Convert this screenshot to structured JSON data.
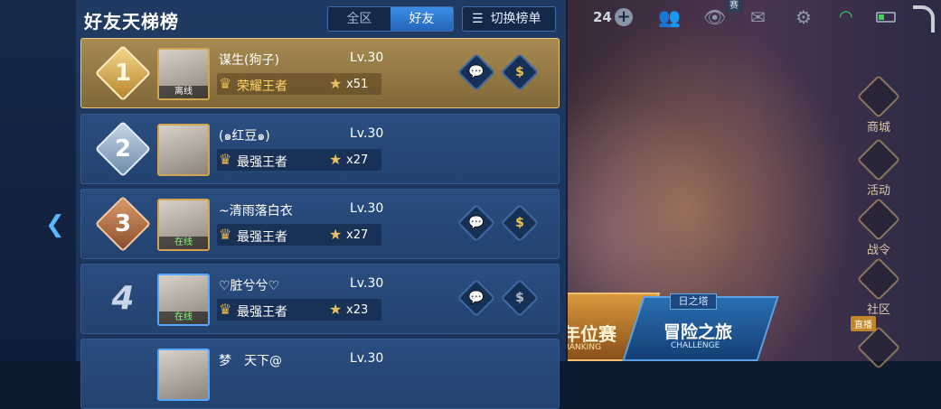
{
  "panel": {
    "title": "好友天梯榜",
    "tabs": [
      {
        "label": "全区",
        "active": false
      },
      {
        "label": "好友",
        "active": true
      }
    ],
    "switch_label": "切换榜单"
  },
  "rows": [
    {
      "rank": "1",
      "name": "谋生(狗子)",
      "level": "Lv.30",
      "tier": "荣耀王者",
      "stars": "x51",
      "status": "离线"
    },
    {
      "rank": "2",
      "name": "(๑红豆๑)",
      "level": "Lv.30",
      "tier": "最强王者",
      "stars": "x27",
      "status": ""
    },
    {
      "rank": "3",
      "name": "~清雨落白衣",
      "level": "Lv.30",
      "tier": "最强王者",
      "stars": "x27",
      "status": "在线"
    },
    {
      "rank": "4",
      "name": "♡脏兮兮♡",
      "level": "Lv.30",
      "tier": "最强王者",
      "stars": "x23",
      "status": "在线"
    },
    {
      "rank": "",
      "name": "梦　天下@",
      "level": "Lv.30",
      "tier": "",
      "stars": "",
      "status": ""
    }
  ],
  "topbar": {
    "count": "24",
    "sai": "赛"
  },
  "right_menu": [
    {
      "label": "商城",
      "icon": "shop-icon"
    },
    {
      "label": "活动",
      "icon": "gift-icon"
    },
    {
      "label": "战令",
      "icon": "flag-icon"
    },
    {
      "label": "社区",
      "icon": "community-icon"
    },
    {
      "label": "",
      "icon": "trophy-icon"
    }
  ],
  "live_badge": "直播",
  "banners": {
    "ranked_text": "年位赛",
    "ranked_sub": "RANKING",
    "adventure_tag": "日之塔",
    "adventure_text": "冒险之旅",
    "adventure_sub": "CHALLENGE"
  },
  "colors": {
    "accent": "#3b8ee6",
    "gold": "#e8c97a",
    "online": "#7dff7a",
    "panel": "#203a63"
  }
}
